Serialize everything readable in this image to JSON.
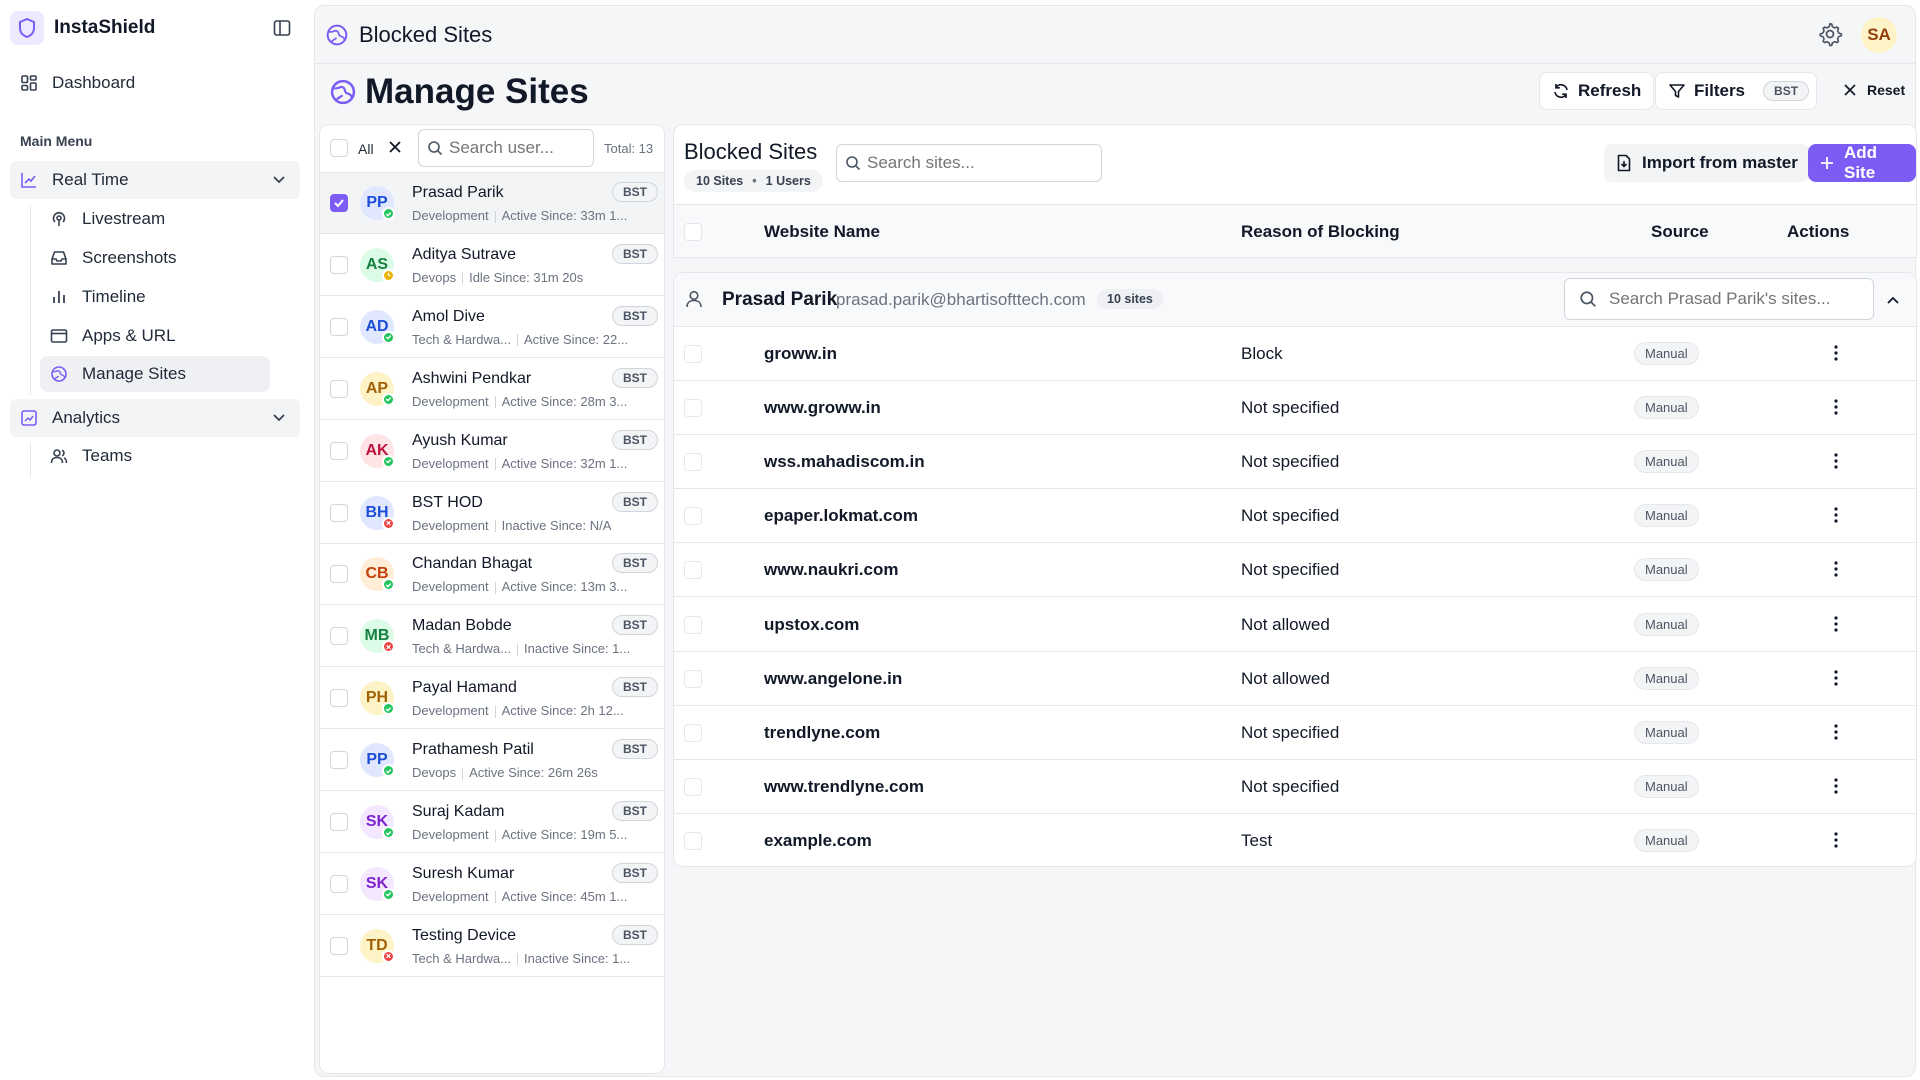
{
  "app": {
    "name": "InstaShield"
  },
  "sidebar": {
    "dashboard": "Dashboard",
    "section_label": "Main Menu",
    "realtime": {
      "label": "Real Time",
      "items": [
        {
          "label": "Livestream",
          "icon": "broadcast-icon"
        },
        {
          "label": "Screenshots",
          "icon": "inbox-icon"
        },
        {
          "label": "Timeline",
          "icon": "bar-chart-icon"
        },
        {
          "label": "Apps & URL",
          "icon": "browser-window-icon"
        },
        {
          "label": "Manage Sites",
          "icon": "globe-icon",
          "active": true
        }
      ]
    },
    "analytics": {
      "label": "Analytics",
      "items": [
        {
          "label": "Teams",
          "icon": "users-icon"
        }
      ]
    }
  },
  "topbar": {
    "title": "Blocked Sites",
    "avatar": "SA"
  },
  "page": {
    "title": "Manage Sites"
  },
  "toolbar": {
    "refresh": "Refresh",
    "filters": "Filters",
    "filter_chip": "BST",
    "reset": "Reset"
  },
  "users": {
    "all_label": "All",
    "search_placeholder": "Search user...",
    "total": "Total: 13",
    "list": [
      {
        "initials": "PP",
        "name": "Prasad Parik",
        "dept": "Development",
        "status": "Active Since: 33m 1...",
        "state": "active",
        "badge": "BST",
        "selected": true
      },
      {
        "initials": "AS",
        "name": "Aditya Sutrave",
        "dept": "Devops",
        "status": "Idle Since: 31m 20s",
        "state": "idle",
        "badge": "BST"
      },
      {
        "initials": "AD",
        "name": "Amol Dive",
        "dept": "Tech & Hardwa...",
        "status": "Active Since: 22...",
        "state": "active",
        "badge": "BST"
      },
      {
        "initials": "AP",
        "name": "Ashwini Pendkar",
        "dept": "Development",
        "status": "Active Since: 28m 3...",
        "state": "active",
        "badge": "BST"
      },
      {
        "initials": "AK",
        "name": "Ayush Kumar",
        "dept": "Development",
        "status": "Active Since: 32m 1...",
        "state": "active",
        "badge": "BST"
      },
      {
        "initials": "BH",
        "name": "BST HOD",
        "dept": "Development",
        "status": "Inactive Since: N/A",
        "state": "inactive",
        "badge": "BST"
      },
      {
        "initials": "CB",
        "name": "Chandan Bhagat",
        "dept": "Development",
        "status": "Active Since: 13m 3...",
        "state": "active",
        "badge": "BST"
      },
      {
        "initials": "MB",
        "name": "Madan Bobde",
        "dept": "Tech & Hardwa...",
        "status": "Inactive Since: 1...",
        "state": "inactive",
        "badge": "BST"
      },
      {
        "initials": "PH",
        "name": "Payal Hamand",
        "dept": "Development",
        "status": "Active Since: 2h 12...",
        "state": "active",
        "badge": "BST"
      },
      {
        "initials": "PP",
        "name": "Prathamesh Patil",
        "dept": "Devops",
        "status": "Active Since: 26m 26s",
        "state": "active",
        "badge": "BST"
      },
      {
        "initials": "SK",
        "name": "Suraj Kadam",
        "dept": "Development",
        "status": "Active Since: 19m 5...",
        "state": "active",
        "badge": "BST"
      },
      {
        "initials": "SK",
        "name": "Suresh Kumar",
        "dept": "Development",
        "status": "Active Since: 45m 1...",
        "state": "active",
        "badge": "BST"
      },
      {
        "initials": "TD",
        "name": "Testing Device",
        "dept": "Tech & Hardwa...",
        "status": "Inactive Since: 1...",
        "state": "inactive",
        "badge": "BST"
      }
    ]
  },
  "sites": {
    "title": "Blocked Sites",
    "count_sites": "10 Sites",
    "count_users": "1 Users",
    "search_placeholder": "Search sites...",
    "import_label": "Import from master",
    "add_label": "Add Site",
    "columns": [
      "Website Name",
      "Reason of Blocking",
      "Source",
      "Actions"
    ],
    "group": {
      "name": "Prasad Parik",
      "email": "prasad.parik@bhartisofttech.com",
      "count": "10 sites",
      "search_placeholder": "Search Prasad Parik's sites...",
      "rows": [
        {
          "site": "groww.in",
          "reason": "Block",
          "source": "Manual"
        },
        {
          "site": "www.groww.in",
          "reason": "Not specified",
          "source": "Manual"
        },
        {
          "site": "wss.mahadiscom.in",
          "reason": "Not specified",
          "source": "Manual"
        },
        {
          "site": "epaper.lokmat.com",
          "reason": "Not specified",
          "source": "Manual"
        },
        {
          "site": "www.naukri.com",
          "reason": "Not specified",
          "source": "Manual"
        },
        {
          "site": "upstox.com",
          "reason": "Not allowed",
          "source": "Manual"
        },
        {
          "site": "www.angelone.in",
          "reason": "Not allowed",
          "source": "Manual"
        },
        {
          "site": "trendlyne.com",
          "reason": "Not specified",
          "source": "Manual"
        },
        {
          "site": "www.trendlyne.com",
          "reason": "Not specified",
          "source": "Manual"
        },
        {
          "site": "example.com",
          "reason": "Test",
          "source": "Manual"
        }
      ]
    }
  },
  "colors": {
    "accent": "#7c5cf5",
    "active": "#22c55e",
    "idle": "#eab308",
    "inactive": "#ef4444"
  }
}
